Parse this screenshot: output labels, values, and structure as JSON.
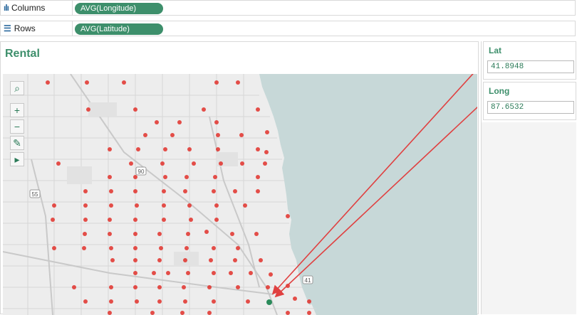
{
  "shelves": {
    "columns": {
      "label": "Columns",
      "pill": "AVG(Longitude)"
    },
    "rows": {
      "label": "Rows",
      "pill": "AVG(Latitude)"
    }
  },
  "worksheet": {
    "title": "Rental"
  },
  "map_toolbar": {
    "search": "⌕",
    "zoom_in": "+",
    "zoom_out": "−",
    "pin": "✎",
    "expand": "▸"
  },
  "map_labels": {
    "interstate_90": "90",
    "highway_55": "55",
    "highway_41": "41"
  },
  "parameters": {
    "lat": {
      "label": "Lat",
      "value": "41.8948"
    },
    "long": {
      "label": "Long",
      "value": "87.6532"
    }
  },
  "colors": {
    "accent": "#3d8f6b",
    "point": "#e0302a",
    "highlight_point": "#2a8a5a",
    "lake": "#c7d8d8",
    "land": "#ededed",
    "arrow": "#e04040"
  }
}
